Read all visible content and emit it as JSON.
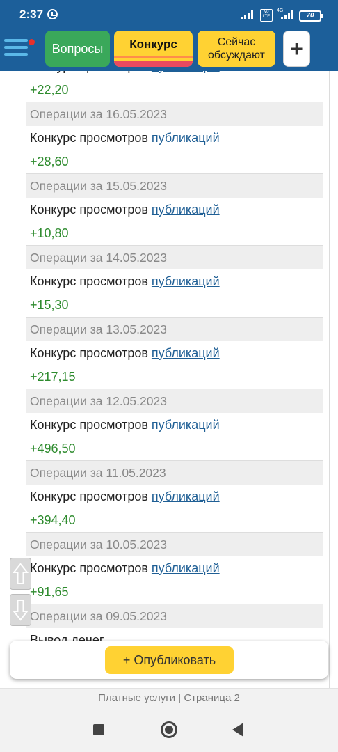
{
  "status_bar": {
    "time": "2:37",
    "network_label": "4G",
    "volte_label": "Vo LTE",
    "battery": "70"
  },
  "nav": {
    "tabs": {
      "questions": "Вопросы",
      "contest": "Конкурс",
      "discuss": "Сейчас обсуждают",
      "plus": "+"
    }
  },
  "operations": {
    "link_text": "публикаций",
    "top_partial_amount": "+22,20",
    "items": [
      {
        "date": "Операции за 16.05.2023",
        "description": "Конкурс просмотров ",
        "amount": "+28,60"
      },
      {
        "date": "Операции за 15.05.2023",
        "description": "Конкурс просмотров ",
        "amount": "+10,80"
      },
      {
        "date": "Операции за 14.05.2023",
        "description": "Конкурс просмотров ",
        "amount": "+15,30"
      },
      {
        "date": "Операции за 13.05.2023",
        "description": "Конкурс просмотров ",
        "amount": "+217,15"
      },
      {
        "date": "Операции за 12.05.2023",
        "description": "Конкурс просмотров ",
        "amount": "+496,50"
      },
      {
        "date": "Операции за 11.05.2023",
        "description": "Конкурс просмотров ",
        "amount": "+394,40"
      },
      {
        "date": "Операции за 10.05.2023",
        "description": "Конкурс просмотров ",
        "amount": "+91,65"
      }
    ],
    "last": {
      "date": "Операции за 09.05.2023",
      "description": "Вывод денег"
    }
  },
  "publish": {
    "label": "+ Опубликовать"
  },
  "footer": {
    "text": "Платные услуги | Страница 2"
  },
  "colors": {
    "header_blue": "#1c5f9a",
    "accent_yellow": "#ffd233",
    "questions_green": "#3aa85a",
    "amount_green": "#2e8b2e",
    "link_blue": "#1f5f95"
  }
}
